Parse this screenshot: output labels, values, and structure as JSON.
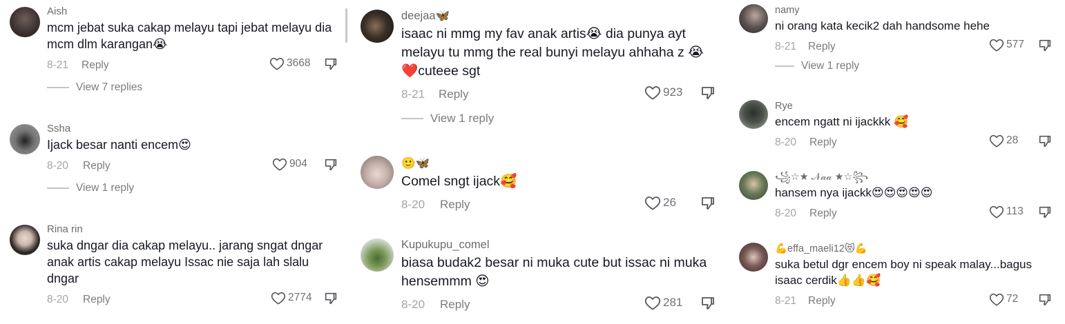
{
  "columns": [
    {
      "comments": [
        {
          "username": "Aish",
          "text": "mcm jebat suka cakap melayu tapi jebat melayu dia mcm dlm karangan😭",
          "date": "8-21",
          "reply": "Reply",
          "likes": "3668",
          "view_replies": "View 7 replies",
          "avatar_color": "#3a3030"
        },
        {
          "username": "Ssha",
          "text": "Ijack besar nanti encem😍",
          "date": "8-20",
          "reply": "Reply",
          "likes": "904",
          "view_replies": "View 1 reply",
          "avatar_color": "#6a6a6a"
        },
        {
          "username": "Rina rin",
          "text": "suka dngar dia cakap melayu.. jarang sngat dngar anak artis cakap melayu Issac nie saja lah slalu dngar",
          "date": "8-20",
          "reply": "Reply",
          "likes": "2774",
          "avatar_color": "#2e2a2a"
        }
      ]
    },
    {
      "comments": [
        {
          "username": "deejaa🦋",
          "text": "isaac ni mmg my fav anak artis😭 dia punya ayt melayu tu mmg the real bunyi melayu ahhaha z 😭❤️cuteee sgt",
          "date": "8-21",
          "reply": "Reply",
          "likes": "923",
          "view_replies": "View 1 reply",
          "avatar_color": "#3b3128"
        },
        {
          "username": "🙂🦋",
          "text": "Comel sngt ijack🥰",
          "date": "8-20",
          "reply": "Reply",
          "likes": "26",
          "avatar_color": "#c8b3ad"
        },
        {
          "username": "Kupukupu_comel",
          "text": "biasa budak2 besar ni muka cute but issac ni muka hensemmm 😍",
          "date": "8-20",
          "reply": "Reply",
          "likes": "281",
          "avatar_color": "#7f9a5c"
        }
      ]
    },
    {
      "comments": [
        {
          "username": "namy",
          "text": "ni orang kata kecik2 dah handsome hehe",
          "date": "8-21",
          "reply": "Reply",
          "likes": "577",
          "view_replies": "View 1 reply",
          "avatar_color": "#5a5250"
        },
        {
          "username": "Rye",
          "text": "encem ngatt ni ijackkk 🥰",
          "date": "8-20",
          "reply": "Reply",
          "likes": "28",
          "avatar_color": "#4d524b"
        },
        {
          "username": "꧁☆★ 𝒩𝒶𝒶 ★☆꧂",
          "text": "hansem nya ijackk😍😍😍😍😍",
          "date": "8-20",
          "reply": "Reply",
          "likes": "113",
          "avatar_color": "#6b7a5a"
        },
        {
          "username": "💪effa_maeli12😻💪",
          "text": "suka betul dgr encem boy ni speak malay...bagus isaac cerdik👍👍🥰",
          "date": "8-21",
          "reply": "Reply",
          "likes": "72",
          "avatar_color": "#7a5a56"
        }
      ]
    }
  ],
  "icons": {
    "like": "heart-outline-icon",
    "dislike": "thumbs-down-icon"
  }
}
